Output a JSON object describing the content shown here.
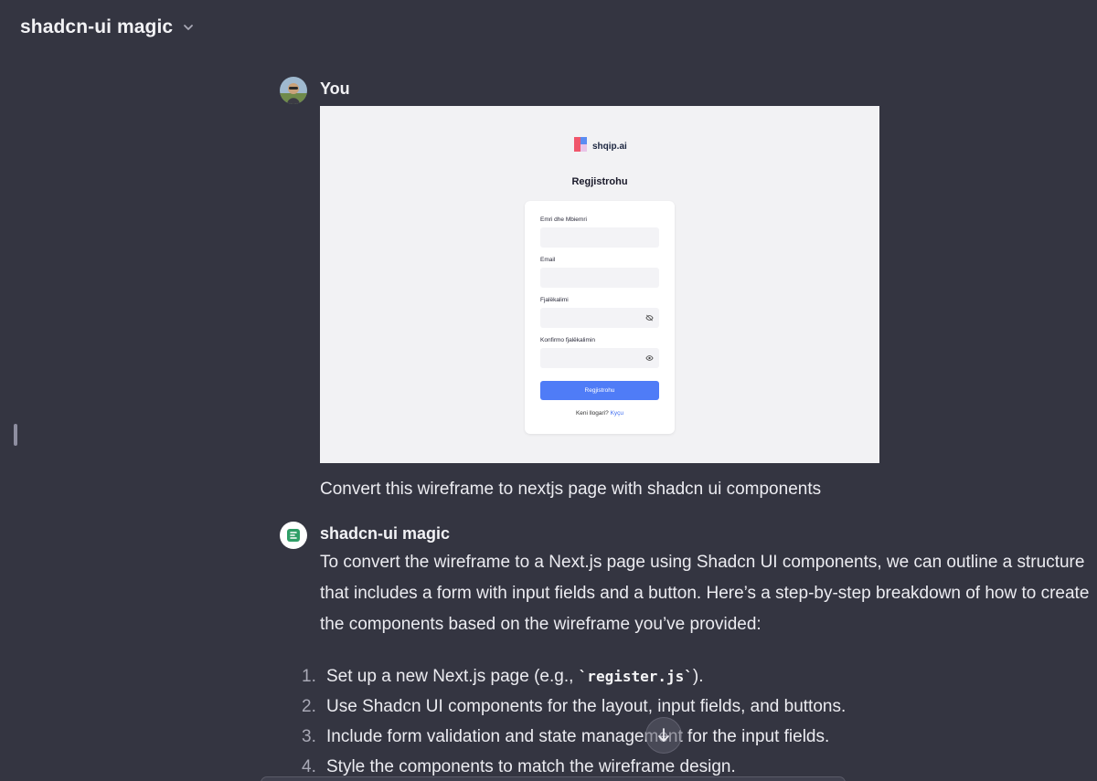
{
  "header": {
    "title": "shadcn-ui magic",
    "chevron_icon": "chevron-down-icon"
  },
  "user_message": {
    "author": "You",
    "text": "Convert this wireframe to nextjs page with shadcn ui components",
    "attachment": {
      "logo_text": "shqip.ai",
      "heading": "Regjistrohu",
      "fields": [
        {
          "label": "Emri dhe Mbiemri",
          "icon": ""
        },
        {
          "label": "Email",
          "icon": ""
        },
        {
          "label": "Fjalëkalimi",
          "icon": "eye-off-icon"
        },
        {
          "label": "Konfirmo fjalëkalimin",
          "icon": "eye-icon"
        }
      ],
      "button_label": "Regjistrohu",
      "footer_text": "Keni llogari?",
      "footer_link": "Kyçu",
      "colors": {
        "button": "#4f7cf7",
        "background": "#f2f2f4"
      }
    }
  },
  "assistant_message": {
    "author": "shadcn-ui magic",
    "paragraph": "To convert the wireframe to a Next.js page using Shadcn UI components, we can outline a structure that includes a form with input fields and a button. Here’s a step-by-step breakdown of how to create the components based on the wireframe you’ve provided:",
    "steps": [
      {
        "num": "1.",
        "before": "Set up a new Next.js page (e.g., ",
        "code": "`register.js`",
        "after": ")."
      },
      {
        "num": "2.",
        "before": "Use Shadcn UI components for the layout, input fields, and buttons.",
        "code": "",
        "after": ""
      },
      {
        "num": "3.",
        "before": "Include form validation and state management for the input fields.",
        "code": "",
        "after": ""
      },
      {
        "num": "4.",
        "before": "Style the components to match the wireframe design.",
        "code": "",
        "after": ""
      }
    ]
  },
  "colors": {
    "background": "#343541",
    "text": "#ececf1"
  }
}
